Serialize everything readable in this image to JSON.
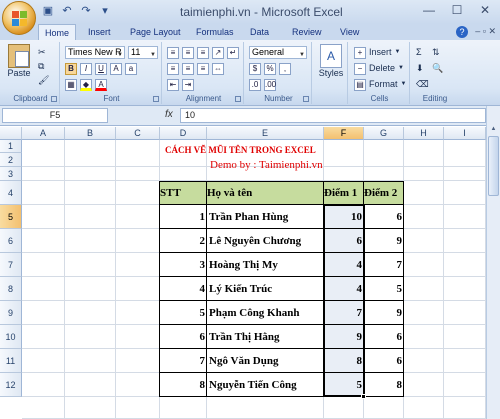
{
  "window": {
    "title": "taimienphi.vn - Microsoft Excel"
  },
  "qat": {
    "save_icon": "save-icon",
    "undo_icon": "undo-icon",
    "redo_icon": "redo-icon"
  },
  "tabs": [
    "Home",
    "Insert",
    "Page Layout",
    "Formulas",
    "Data",
    "Review",
    "View"
  ],
  "ribbon": {
    "clipboard": {
      "label": "Clipboard",
      "paste": "Paste"
    },
    "font": {
      "label": "Font",
      "family": "Times New R",
      "size": "11",
      "bold": "B",
      "italic": "I",
      "underline": "U"
    },
    "alignment": {
      "label": "Alignment"
    },
    "number": {
      "label": "Number",
      "format": "General",
      "currency": "$",
      "percent": "%",
      "comma": ","
    },
    "styles": {
      "label": "Styles"
    },
    "cells": {
      "label": "Cells",
      "insert": "Insert",
      "delete": "Delete",
      "format": "Format"
    },
    "editing": {
      "label": "Editing"
    }
  },
  "formula_bar": {
    "name_box": "F5",
    "fx": "fx",
    "value": "10"
  },
  "columns": [
    "A",
    "B",
    "C",
    "D",
    "E",
    "F",
    "G",
    "H",
    "I"
  ],
  "rows": [
    "1",
    "2",
    "3",
    "4",
    "5",
    "6",
    "7",
    "8",
    "9",
    "10",
    "11",
    "12"
  ],
  "sheet": {
    "title": "CÁCH VẼ MŨI TÊN TRONG EXCEL",
    "subtitle": "Demo by : Taimienphi.vn",
    "headers": [
      "STT",
      "Họ và tên",
      "Điểm 1",
      "Điểm 2"
    ],
    "data": [
      [
        "1",
        "Trần Phan Hùng",
        "10",
        "6"
      ],
      [
        "2",
        "Lê Nguyên Chương",
        "6",
        "9"
      ],
      [
        "3",
        "Hoàng Thị My",
        "4",
        "7"
      ],
      [
        "4",
        "Lý Kiến Trúc",
        "4",
        "5"
      ],
      [
        "5",
        "Phạm Công Khanh",
        "7",
        "9"
      ],
      [
        "6",
        "Trần Thị Hằng",
        "9",
        "6"
      ],
      [
        "7",
        "Ngô Văn Dụng",
        "8",
        "6"
      ],
      [
        "8",
        "Nguyễn Tiến Công",
        "5",
        "8"
      ]
    ]
  },
  "selection": {
    "active_cell": "F5"
  }
}
